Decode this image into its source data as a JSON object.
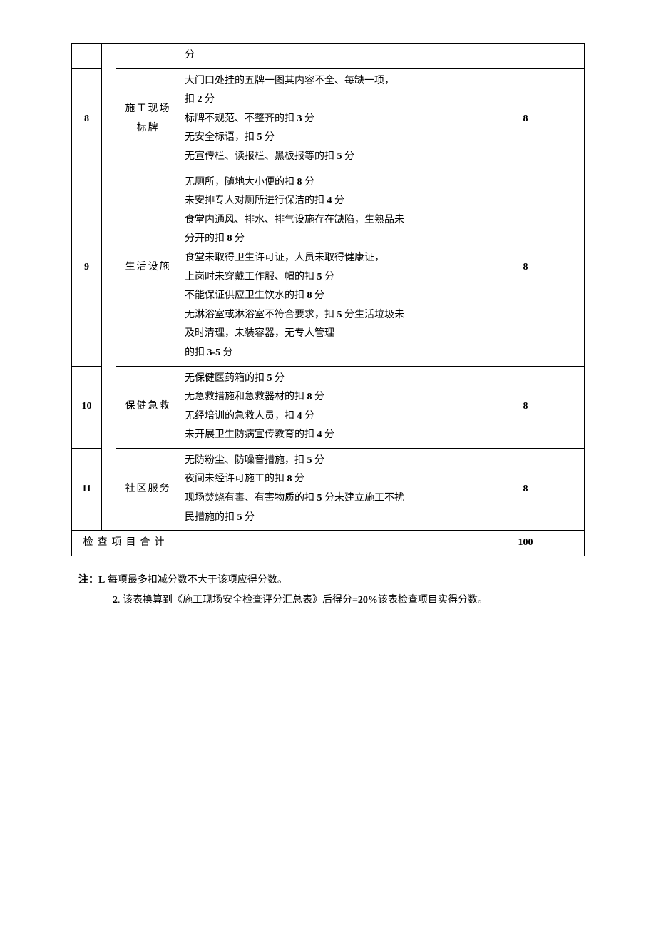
{
  "rows": [
    {
      "num": "",
      "category": "",
      "desc_lines": [
        "分"
      ],
      "score": "",
      "first_row": true
    },
    {
      "num": "8",
      "category": "施工现场标牌",
      "desc_lines": [
        "大门口处挂的五牌一图其内容不全、每缺一项，",
        "扣 <b>2</b> 分",
        "标牌不规范、不整齐的扣 <b>3</b> 分",
        "无安全标语，扣 <b>5</b> 分",
        "无宣传栏、读报栏、黑板报等的扣 <b>5</b> 分"
      ],
      "score": "8"
    },
    {
      "num": "9",
      "category": "生活设施",
      "desc_lines": [
        "无厕所，随地大小便的扣 <b>8</b> 分",
        "未安排专人对厕所进行保洁的扣 <b>4</b> 分",
        "食堂内通风、排水、排气设施存在缺陷，生熟品未",
        "分开的扣 <b>8</b> 分",
        "食堂未取得卫生许可证，人员未取得健康证，",
        "上岗时未穿戴工作服、帽的扣 <b>5</b> 分",
        "不能保证供应卫生饮水的扣 <b>8</b> 分",
        "无淋浴室或淋浴室不符合要求，扣 <b>5</b> 分生活垃圾未",
        "及时清理，未装容器，无专人管理",
        "的扣 <b>3-5</b> 分"
      ],
      "score": "8"
    },
    {
      "num": "10",
      "category": "保健急救",
      "desc_lines": [
        "无保健医药箱的扣 <b>5</b> 分",
        "无急救措施和急救器材的扣 <b>8</b> 分",
        "无经培训的急救人员，扣 <b>4</b> 分",
        "未开展卫生防病宣传教育的扣 <b>4</b> 分"
      ],
      "score": "8"
    },
    {
      "num": "11",
      "category": "社区服务",
      "desc_lines": [
        "无防粉尘、防噪音措施，扣 <b>5</b> 分",
        "夜间未经许可施工的扣 <b>8</b> 分",
        "现场焚烧有毒、有害物质的扣 <b>5</b> 分未建立施工不扰",
        "民措施的扣 <b>5</b> 分"
      ],
      "score": "8"
    }
  ],
  "total": {
    "label": "检查项目合计",
    "score": "100"
  },
  "notes": {
    "prefix": "注：",
    "note1_bold": "L",
    "note1_text": " 每项最多扣减分数不大于该项应得分数。",
    "note2_bold": "2",
    "note2_text": ". 该表换算到《施工现场安全检查评分汇总表》后得分=",
    "note2_bold2": "20%",
    "note2_text2": "该表检查项目实得分数。"
  }
}
